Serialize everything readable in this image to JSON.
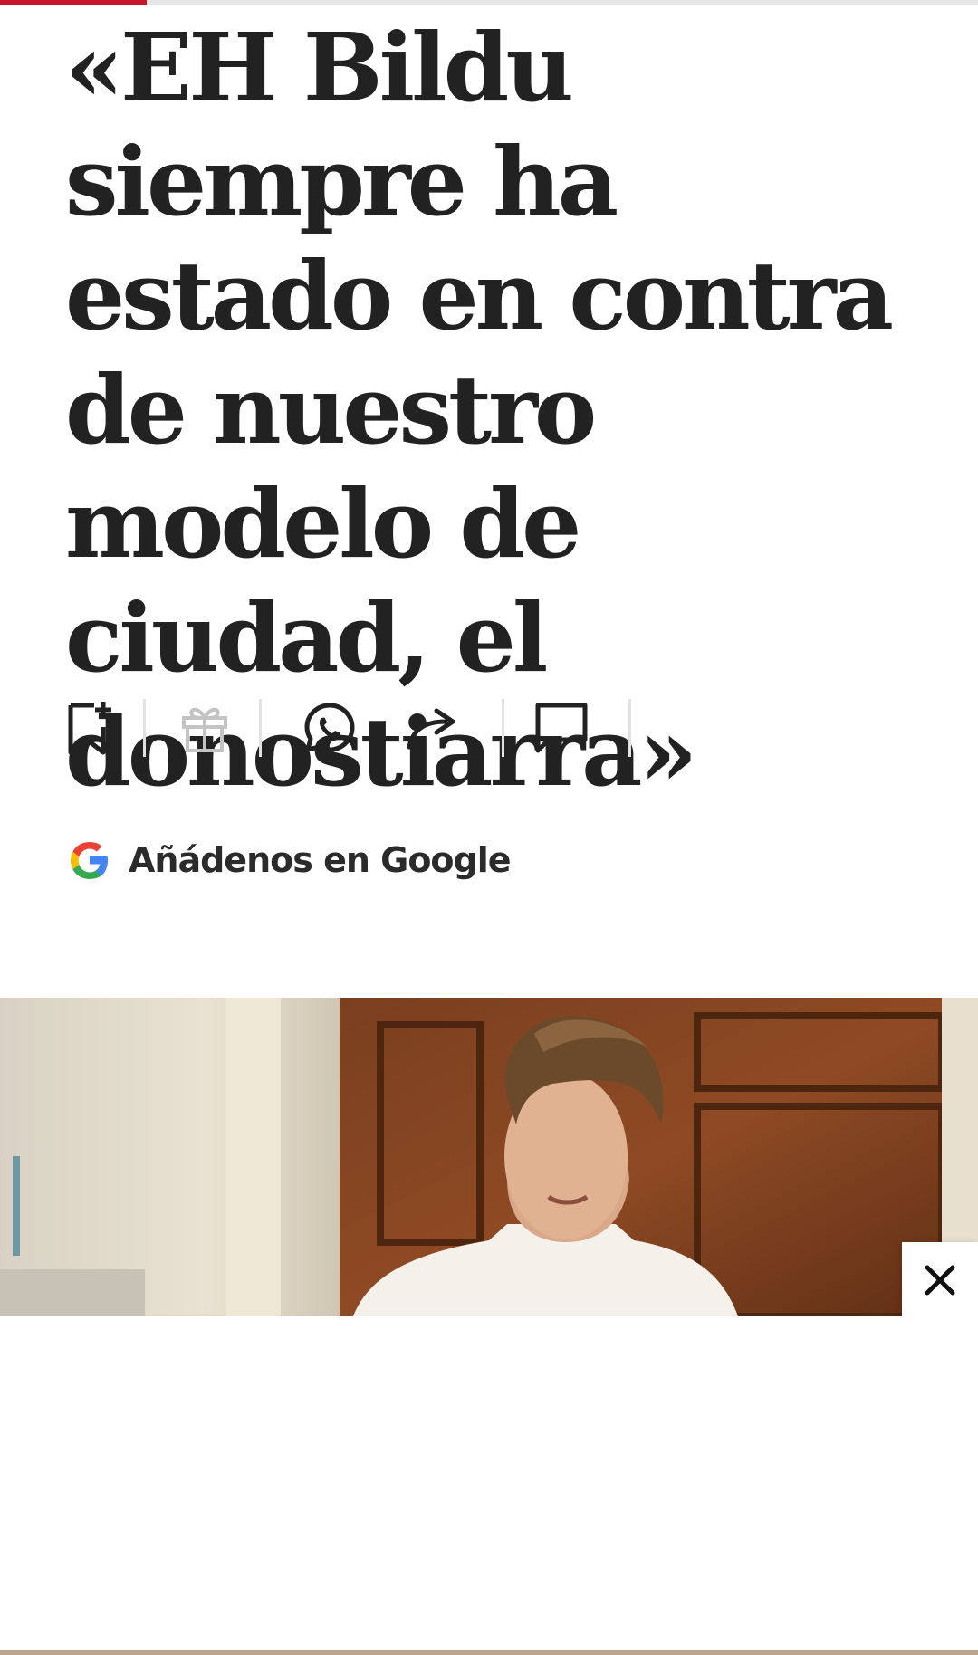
{
  "reading_progress": {
    "percent": 15,
    "color": "#c5162e"
  },
  "article": {
    "headline": "«EH Bildu siempre ha estado en contra de nuestro modelo de ciudad, el donostiarra»"
  },
  "actions": [
    {
      "name": "bookmark-add-icon"
    },
    {
      "name": "gift-icon",
      "state": "disabled"
    },
    {
      "name": "whatsapp-icon"
    },
    {
      "name": "share-icon"
    },
    {
      "name": "comment-icon"
    }
  ],
  "google_follow": {
    "label": "Añádenos en Google",
    "icon": "google-g-icon"
  },
  "photo": {
    "description_icon": "photo-man-speaking"
  },
  "overlay": {
    "close_icon": "close-icon"
  },
  "colors": {
    "text": "#222222",
    "brand_red": "#c5162e",
    "divider": "#e2e2e2"
  }
}
